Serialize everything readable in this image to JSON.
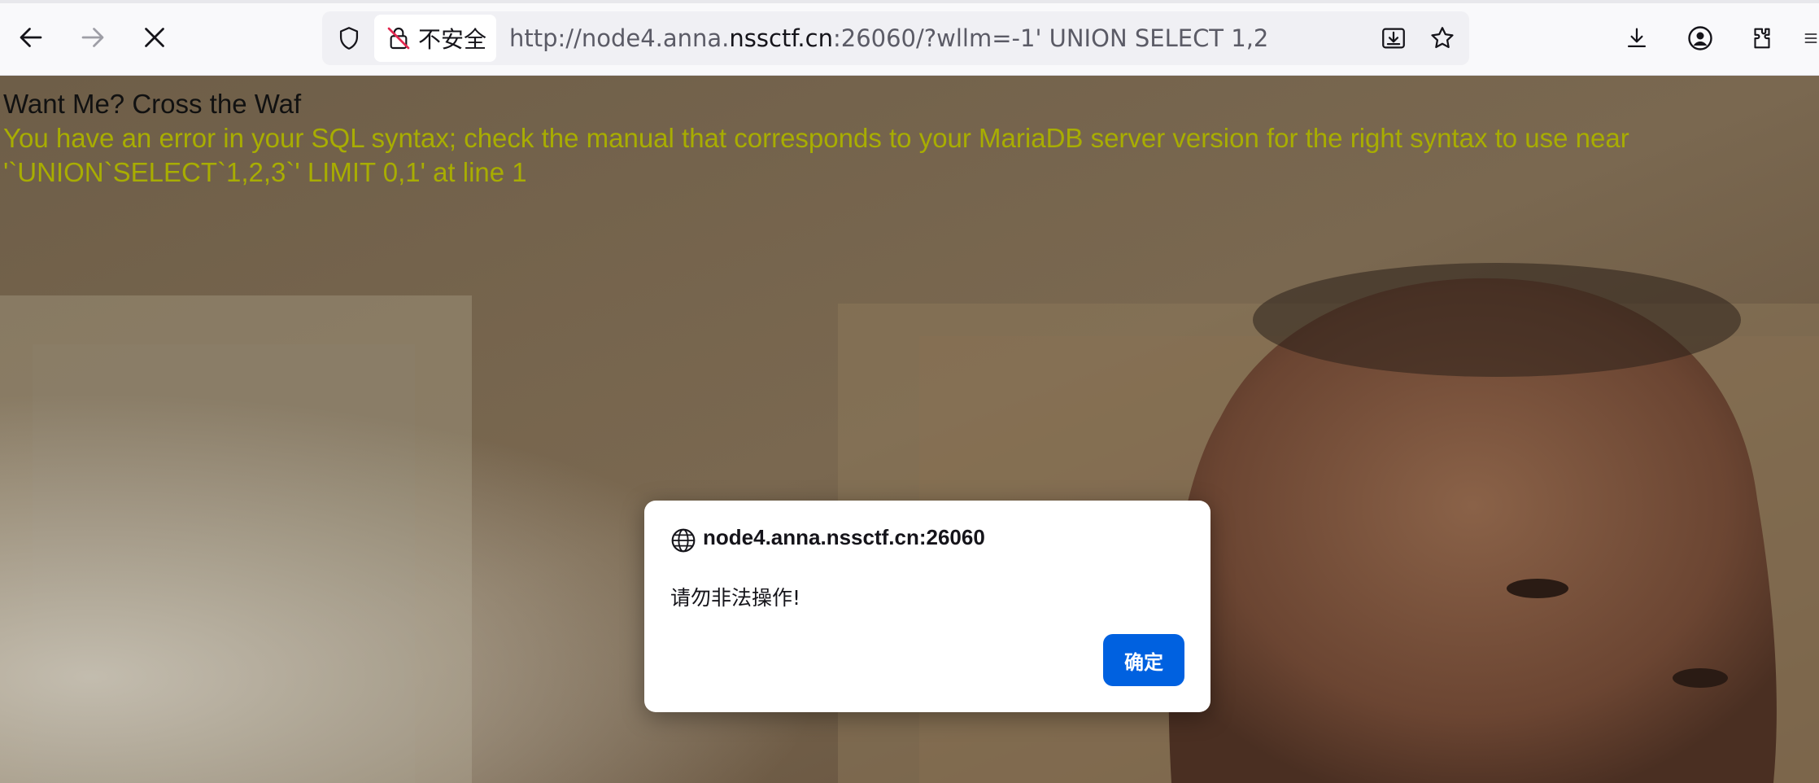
{
  "browser": {
    "insecure_label": "不安全",
    "url_prefix": "http://node4.anna.",
    "url_host": "nssctf.cn",
    "url_suffix": ":26060/?wllm=-1' UNION SELECT 1,2",
    "icons": [
      "back-arrow-icon",
      "forward-arrow-icon",
      "stop-icon",
      "shield-icon",
      "insecure-lock-icon",
      "download-page-icon",
      "bookmark-star-icon",
      "downloads-icon",
      "account-icon",
      "extensions-icon",
      "menu-icon"
    ]
  },
  "page": {
    "heading": "Want Me? Cross the Waf",
    "error_line1": "You have an error in your SQL syntax; check the manual that corresponds to your MariaDB server version for the right syntax to use near",
    "error_line2": "'`UNION`SELECT`1,2,3`' LIMIT 0,1' at line 1",
    "error_color": "#a8ad00"
  },
  "dialog": {
    "origin": "node4.anna.nssctf.cn:26060",
    "message": "请勿非法操作!",
    "ok_label": "确定",
    "button_color": "#0061e0"
  }
}
